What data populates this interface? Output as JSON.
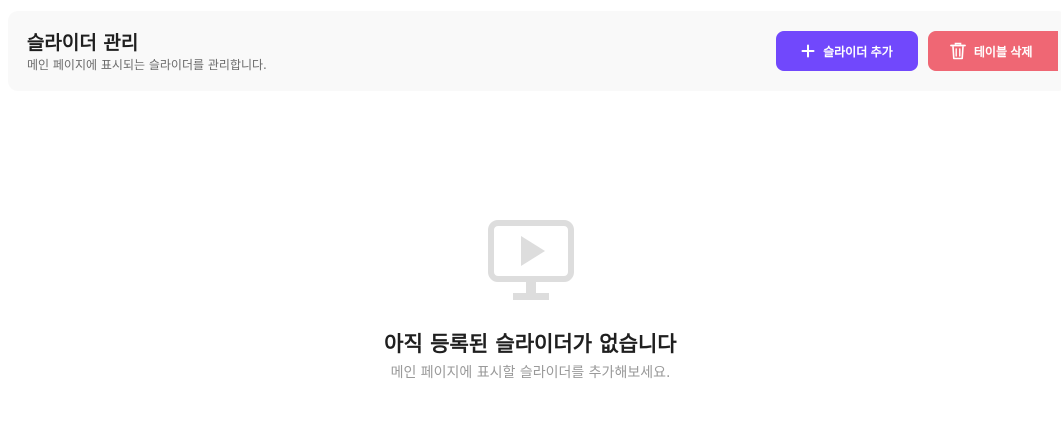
{
  "header": {
    "title": "슬라이더 관리",
    "subtitle": "메인 페이지에 표시되는 슬라이더를 관리합니다."
  },
  "actions": {
    "add_label": "슬라이더 추가",
    "add_icon": "plus-icon",
    "delete_label": "테이블 삭제",
    "delete_icon": "trash-icon"
  },
  "empty_state": {
    "icon": "monitor-play-icon",
    "title": "아직 등록된 슬라이더가 없습니다",
    "description": "메인 페이지에 표시할 슬라이더를 추가해보세요."
  },
  "colors": {
    "primary": "#7148fc",
    "danger": "#ef6774",
    "header_bg": "#f9f9f9",
    "muted_icon": "#dddddd"
  }
}
